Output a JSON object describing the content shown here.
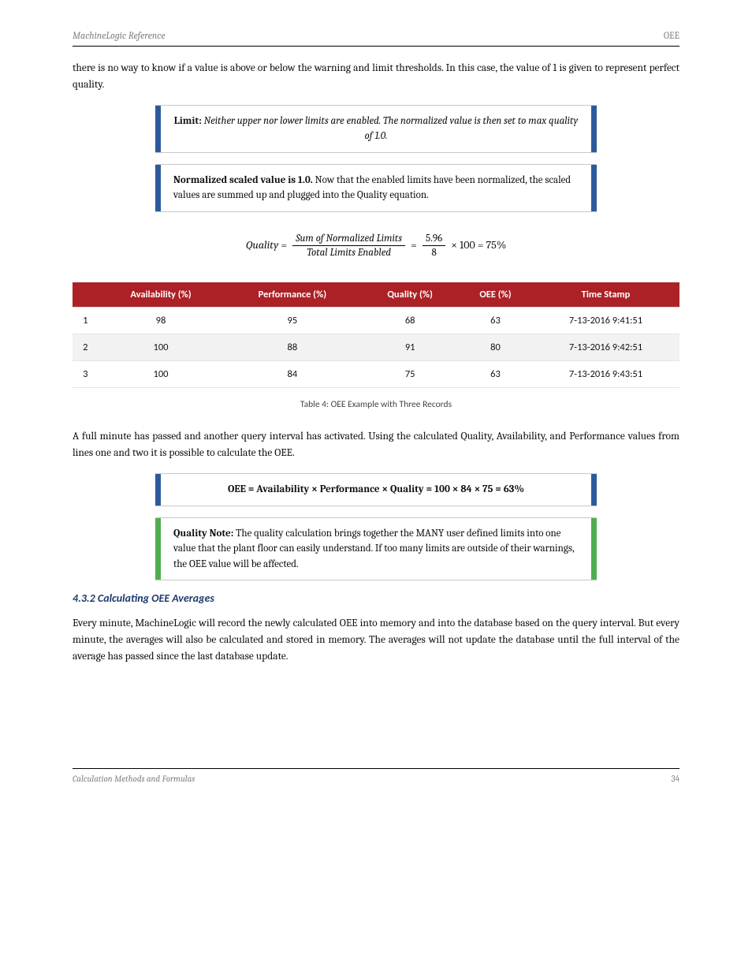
{
  "header": {
    "left": "MachineLogic Reference",
    "right": "OEE"
  },
  "intro_para": "there is no way to know if a value is above or below the warning and limit thresholds. In this case, the value of 1 is given to represent perfect quality.",
  "callouts1": [
    {
      "left_edge": "blue",
      "right_edge": "blue",
      "center": true,
      "bold_label": "Limit: ",
      "italic_text": "Neither upper nor lower limits are enabled. The normalized value is then set to max quality of 1.0."
    },
    {
      "left_edge": "blue",
      "right_edge": "blue",
      "center": false,
      "bold_label": "Normalized scaled value is ",
      "bold_value": "1.0.",
      "plain": " Now that the enabled limits have been normalized, the scaled values are summed up and plugged into the Quality equation."
    }
  ],
  "equation": {
    "lhs": "Quality",
    "frac1_num": "Sum of Normalized Limits",
    "frac1_den": "Total Limits Enabled",
    "frac2_num": "5.96",
    "frac2_den": "8",
    "mult": " × 100 = ",
    "result": " 75%"
  },
  "table_headers": [
    "",
    "Availability (%)",
    "Performance (%)",
    "Quality (%)",
    "OEE (%)",
    "Time Stamp"
  ],
  "table_rows": [
    {
      "cells": [
        "1",
        "98",
        "95",
        "68",
        "63",
        "7-13-2016 9:41:51"
      ]
    },
    {
      "cells": [
        "2",
        "100",
        "88",
        "91",
        "80",
        "7-13-2016 9:42:51"
      ]
    },
    {
      "cells": [
        "3",
        "100",
        "84",
        "75",
        "63",
        "7-13-2016 9:43:51"
      ]
    }
  ],
  "table_caption": "Table 4: OEE Example with Three Records",
  "body_para": "A full minute has passed and another query interval has activated. Using the calculated Quality, Availability, and Performance values from lines one and two it is possible to calculate the OEE.",
  "callouts2": [
    {
      "left_edge": "blue",
      "right_edge": "blue",
      "center": true,
      "bold_full": "OEE = Availability × Performance × Quality = 100 × 84 × 75 = 63%"
    },
    {
      "left_edge": "green",
      "right_edge": "green",
      "center": false,
      "bold_label": "Quality Note:",
      "plain": " The quality calculation brings together the MANY user defined limits into one value that the plant floor can easily understand. If too many limits are outside of their warnings, the OEE value will be affected."
    }
  ],
  "section_heading": "4.3.2 Calculating OEE Averages",
  "section_para": "Every minute, MachineLogic will record the newly calculated OEE into memory and into the database based on the query interval. But every minute, the averages will also be calculated and stored in memory. The averages will not update the database until the full interval of the average has passed since the last database update.",
  "footer": {
    "left": "Calculation Methods and Formulas",
    "right": "34"
  }
}
